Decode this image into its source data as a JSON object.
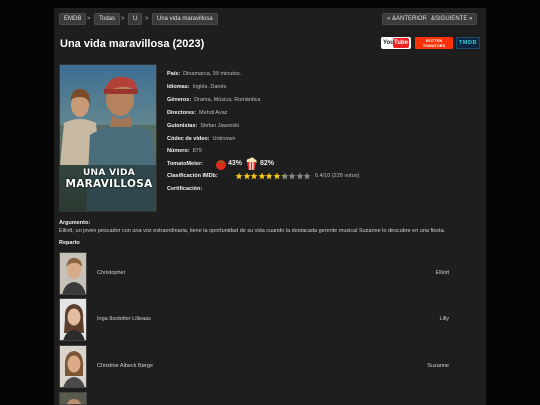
{
  "nav": {
    "breadcrumbs": [
      "EMDB",
      "Todas",
      "U",
      "Una vida maravillosa"
    ],
    "separator": ">",
    "prev_label": "« &ANTERIOR",
    "next_label": "&SIGUIENTE »"
  },
  "movie": {
    "title": "Una vida maravillosa (2023)",
    "poster_text_line1": "UNA VIDA",
    "poster_text_line2": "MARAVILLOSA",
    "poster_credit": "Mehdi Avaz"
  },
  "logos": {
    "youtube": {
      "you": "You",
      "tube": "Tube"
    },
    "rotten": {
      "line1": "ROTTEN",
      "line2": "TOMATOES"
    },
    "tmdb": "TMDB"
  },
  "info": {
    "pais": {
      "label": "País:",
      "value": "Dinamarca, 99 minutos."
    },
    "idiomas": {
      "label": "Idiomas:",
      "value": "Inglés, Danés"
    },
    "generos": {
      "label": "Géneros:",
      "value": "Drama, Música, Romántica"
    },
    "directores": {
      "label": "Directores:",
      "value": "Mehdi Avaz"
    },
    "guionistas": {
      "label": "Guionistas:",
      "value": "Stefan Jaworski"
    },
    "codec": {
      "label": "Códec de vídeo:",
      "value": "Unknown"
    },
    "numero": {
      "label": "Número:",
      "value": "879"
    },
    "tomatometer": {
      "label": "TomatoMeter:",
      "critics": "43%",
      "audience": "82%"
    },
    "imdb": {
      "label": "Clasificación IMDb:",
      "value": "6.4/10 (228 votos)",
      "rating": 6.4,
      "max": 10
    },
    "certificacion": {
      "label": "Certificación:",
      "value": ""
    }
  },
  "plot": {
    "label": "Argumento:",
    "text": "Elliott, un joven pescador con una voz extraordinaria, tiene la oportunidad de su vida cuando la destacada gerente musical Suzanne lo descubre en una fiesta."
  },
  "cast": {
    "label": "Reparto",
    "members": [
      {
        "name": "Christopher",
        "role": "Elliott"
      },
      {
        "name": "Inga Ibsdotter Lilleaas",
        "role": "Lilly"
      },
      {
        "name": "Christine Albeck Børge",
        "role": "Suzanne"
      }
    ]
  },
  "colors": {
    "background": "#050505",
    "panel": "#1e1e1e",
    "star_filled": "#f5c518",
    "star_empty": "#8a8a8a",
    "tomato": "#e12b1e",
    "youtube_red": "#ee2222",
    "rotten_red": "#fa320a",
    "tmdb_accent": "#2fd1d8"
  }
}
